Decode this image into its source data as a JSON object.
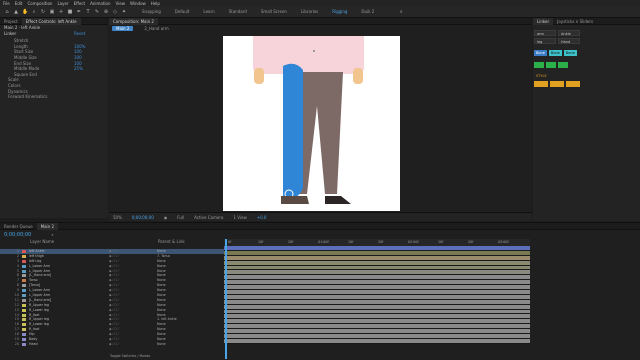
{
  "menu": [
    "File",
    "Edit",
    "Composition",
    "Layer",
    "Effect",
    "Animation",
    "View",
    "Window",
    "Help"
  ],
  "toolbar": {
    "snapping": "Snapping",
    "workspaces": [
      "Default",
      "Learn",
      "Standard",
      "Small Screen",
      "Libraries"
    ],
    "active_workspace": "Rigging",
    "extra": "Duik 2"
  },
  "left_panel": {
    "tabs": [
      "Project",
      "Effect Controls: left Ankle"
    ],
    "subtitle": "Main 2 · left Ankle",
    "effect_name": "Linker",
    "reset": "Reset",
    "properties": [
      {
        "label": "Stretch",
        "val": ""
      },
      {
        "label": "Length",
        "val": "100%"
      },
      {
        "label": "Start Size",
        "val": "100"
      },
      {
        "label": "Middle Size",
        "val": "100"
      },
      {
        "label": "End Size",
        "val": "100"
      },
      {
        "label": "Middle Mode",
        "val": "25%"
      },
      {
        "label": "Square End",
        "val": ""
      },
      {
        "label": "Scale",
        "val": ""
      },
      {
        "label": "Colors",
        "val": ""
      },
      {
        "label": "Dynamics",
        "val": ""
      },
      {
        "label": "Forward Kinematics",
        "val": ""
      }
    ]
  },
  "comp_panel": {
    "tab": "Composition: Main 2",
    "flow_tab": "Main 2",
    "sub_tab": "2_Hand arm",
    "viewer": {
      "zoom": "50%",
      "time": "0;00;00;00",
      "res": "Full",
      "camera": "Active Camera",
      "views": "1 View",
      "offset": "+0.0"
    }
  },
  "right_panel": {
    "tabs": [
      "Linker",
      "Joysticks n Sliders"
    ],
    "field_a": "arm",
    "field_b": "Ankle",
    "field_c": "leg",
    "field_d": "Hand",
    "field_e": "IK",
    "field_f": "Duik",
    "buttons": [
      "Bone",
      "Bone",
      "Bone"
    ],
    "section": "STYLE"
  },
  "timeline": {
    "tabs": [
      "Render Queue",
      "Main 2"
    ],
    "timecode": "0;00;00;00",
    "col_layer": "Layer Name",
    "col_parent": "Parent & Link",
    "ruler_labels": [
      "0f",
      "10f",
      "20f",
      "01:00f",
      "10f",
      "20f",
      "02:00f",
      "10f",
      "20f",
      "03:00f"
    ],
    "footer": "Toggle Switches / Modes",
    "layers": [
      {
        "n": "1",
        "name": "left Ankle",
        "parent": "None",
        "color": "#d85858",
        "track": "#5c6ebc",
        "sel": true
      },
      {
        "n": "2",
        "name": "left thigh",
        "parent": "7. Torso",
        "color": "#d8b058",
        "track": "#7a7a52"
      },
      {
        "n": "3",
        "name": "left Leg",
        "parent": "None",
        "color": "#d85858",
        "track": "#9b8a6c"
      },
      {
        "n": "4",
        "name": "L_Lower Arm",
        "parent": "None",
        "color": "#5c9ec8",
        "track": "#8a8a70"
      },
      {
        "n": "5",
        "name": "L_Upper Arm",
        "parent": "None",
        "color": "#5c9ec8",
        "track": "#8a8a70"
      },
      {
        "n": "6",
        "name": "[L_Hand arm]",
        "parent": "None",
        "color": "#9a9a9a",
        "track": "#8a8a80"
      },
      {
        "n": "7",
        "name": "Torso",
        "parent": "None",
        "color": "#c87a4a",
        "track": "#8a8a8a"
      },
      {
        "n": "8",
        "name": "[Torso]",
        "parent": "None",
        "color": "#9a9a9a",
        "track": "#8a8a8a"
      },
      {
        "n": "9",
        "name": "L_Lower Arm",
        "parent": "None",
        "color": "#5c9ec8",
        "track": "#8a8a8a"
      },
      {
        "n": "10",
        "name": "L_Upper Arm",
        "parent": "None",
        "color": "#5c9ec8",
        "track": "#8a8a8a"
      },
      {
        "n": "11",
        "name": "[L_Hand arm]",
        "parent": "None",
        "color": "#9a9a9a",
        "track": "#8a8a8a"
      },
      {
        "n": "12",
        "name": "R_Upper leg",
        "parent": "None",
        "color": "#c8c058",
        "track": "#8a8a8a"
      },
      {
        "n": "13",
        "name": "R_Lower leg",
        "parent": "None",
        "color": "#c8c058",
        "track": "#8a8a8a"
      },
      {
        "n": "14",
        "name": "R_foot",
        "parent": "None",
        "color": "#c8c058",
        "track": "#8a8a8a"
      },
      {
        "n": "15",
        "name": "R_Upper leg",
        "parent": "1. left Ankle",
        "color": "#c8c058",
        "track": "#8a8a8a"
      },
      {
        "n": "16",
        "name": "R_Lower leg",
        "parent": "None",
        "color": "#c8c058",
        "track": "#8a8a8a"
      },
      {
        "n": "17",
        "name": "R_foot",
        "parent": "None",
        "color": "#c8c058",
        "track": "#8a8a8a"
      },
      {
        "n": "18",
        "name": "Hip",
        "parent": "None",
        "color": "#8a8ac8",
        "track": "#8a8a8a"
      },
      {
        "n": "19",
        "name": "Body",
        "parent": "None",
        "color": "#8a8ac8",
        "track": "#8a8a8a"
      },
      {
        "n": "20",
        "name": "Head",
        "parent": "None",
        "color": "#8a8ac8",
        "track": "#8a8a8a"
      }
    ]
  },
  "colors": {
    "accent": "#4aa4e8",
    "selected_bone": "#2f86d6",
    "selection_row": "#3b5572"
  }
}
